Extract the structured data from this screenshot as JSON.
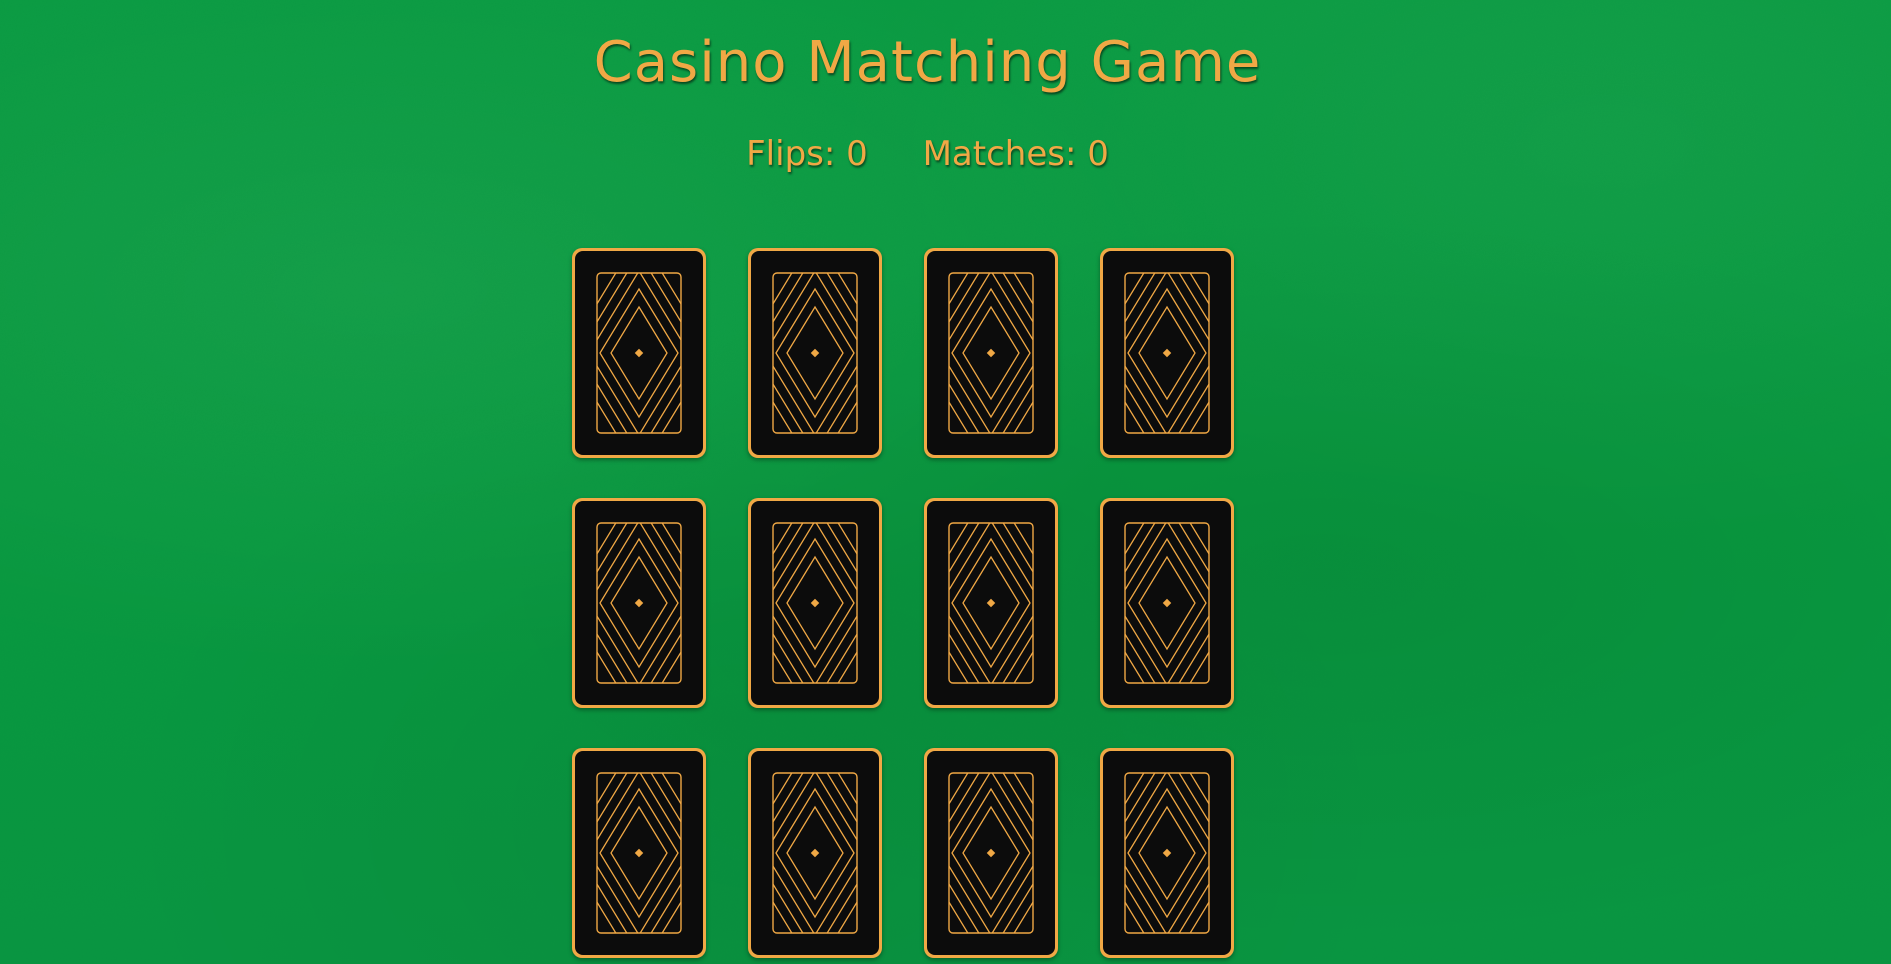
{
  "header": {
    "title": "Casino Matching Game"
  },
  "stats": {
    "flips_label": "Flips: 0",
    "matches_label": "Matches: 0"
  },
  "board": {
    "rows": 3,
    "columns": 4,
    "cards": [
      {
        "state": "face-down"
      },
      {
        "state": "face-down"
      },
      {
        "state": "face-down"
      },
      {
        "state": "face-down"
      },
      {
        "state": "face-down"
      },
      {
        "state": "face-down"
      },
      {
        "state": "face-down"
      },
      {
        "state": "face-down"
      },
      {
        "state": "face-down"
      },
      {
        "state": "face-down"
      },
      {
        "state": "face-down"
      },
      {
        "state": "face-down"
      }
    ]
  },
  "colors": {
    "felt": "#0a9a40",
    "gold": "#f0a845",
    "card_back": "#0c0c0c"
  }
}
